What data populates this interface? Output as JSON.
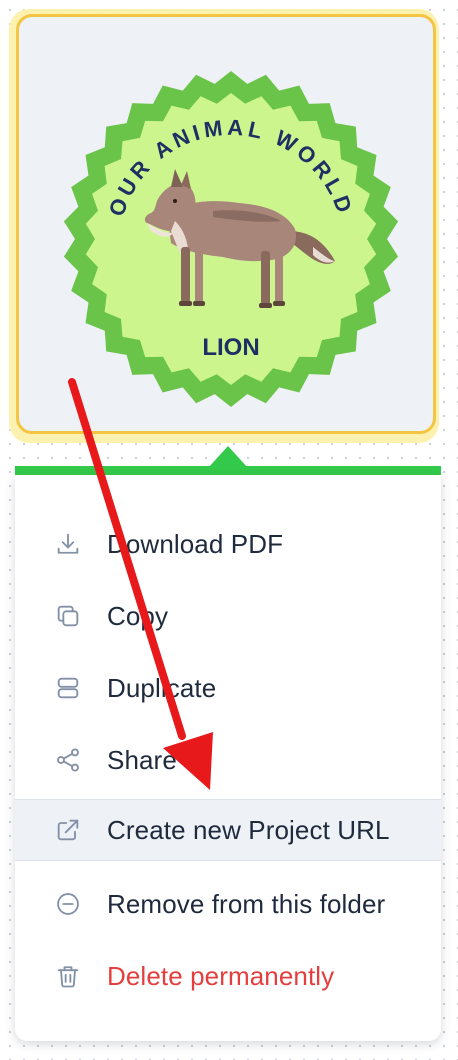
{
  "card": {
    "badge": {
      "arc_text": "OUR ANIMAL WORLD",
      "label": "LION",
      "colors": {
        "outer_ring": "#6bc44a",
        "inner_fill": "#cdf58e",
        "text": "#1e2f64"
      }
    },
    "highlight_color": "#f4c542"
  },
  "menu": {
    "accent_color": "#33c94a",
    "items": [
      {
        "label": "Download PDF",
        "icon": "download-icon"
      },
      {
        "label": "Copy",
        "icon": "copy-icon"
      },
      {
        "label": "Duplicate",
        "icon": "duplicate-icon"
      },
      {
        "label": "Share",
        "icon": "share-icon"
      },
      {
        "label": "Create new Project URL",
        "icon": "external-link-icon",
        "active": true
      },
      {
        "label": "Remove from this folder",
        "icon": "minus-circle-icon"
      },
      {
        "label": "Delete permanently",
        "icon": "trash-icon",
        "danger": true,
        "color": "#e53e3e"
      }
    ]
  },
  "annotation": {
    "arrow_color": "#e8191b"
  }
}
